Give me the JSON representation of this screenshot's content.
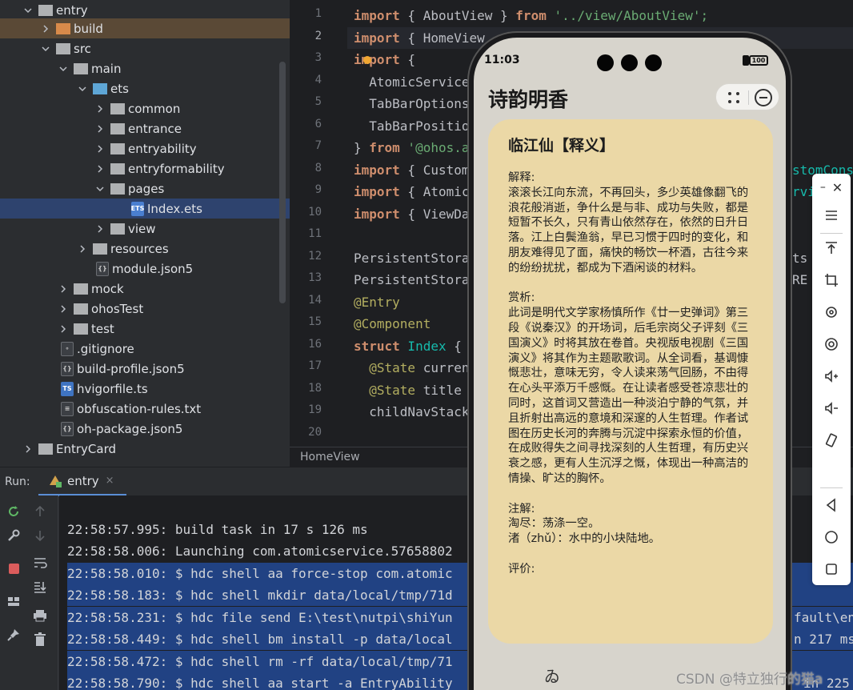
{
  "project_tree": {
    "items": [
      {
        "label": "entry",
        "kind": "module",
        "expanded": true
      },
      {
        "label": "build",
        "kind": "folder-orange",
        "expanded": false
      },
      {
        "label": "src",
        "kind": "folder",
        "expanded": true
      },
      {
        "label": "main",
        "kind": "folder",
        "expanded": true
      },
      {
        "label": "ets",
        "kind": "folder-blue",
        "expanded": true
      },
      {
        "label": "common",
        "kind": "folder",
        "expanded": false
      },
      {
        "label": "entrance",
        "kind": "folder",
        "expanded": false
      },
      {
        "label": "entryability",
        "kind": "folder",
        "expanded": false
      },
      {
        "label": "entryformability",
        "kind": "folder",
        "expanded": false
      },
      {
        "label": "pages",
        "kind": "folder",
        "expanded": true
      },
      {
        "label": "Index.ets",
        "kind": "file-ets",
        "selected": true
      },
      {
        "label": "view",
        "kind": "folder",
        "expanded": false
      },
      {
        "label": "resources",
        "kind": "folder",
        "expanded": false
      },
      {
        "label": "module.json5",
        "kind": "file-json"
      },
      {
        "label": "mock",
        "kind": "folder",
        "expanded": false
      },
      {
        "label": "ohosTest",
        "kind": "folder",
        "expanded": false
      },
      {
        "label": "test",
        "kind": "folder",
        "expanded": false
      },
      {
        "label": ".gitignore",
        "kind": "file-git"
      },
      {
        "label": "build-profile.json5",
        "kind": "file-json"
      },
      {
        "label": "hvigorfile.ts",
        "kind": "file-ts"
      },
      {
        "label": "obfuscation-rules.txt",
        "kind": "file-txt"
      },
      {
        "label": "oh-package.json5",
        "kind": "file-json"
      },
      {
        "label": "EntryCard",
        "kind": "folder",
        "expanded": false
      }
    ]
  },
  "editor": {
    "line_numbers": [
      "1",
      "2",
      "3",
      "4",
      "5",
      "6",
      "7",
      "8",
      "9",
      "10",
      "11",
      "12",
      "13",
      "14",
      "15",
      "16",
      "17",
      "18",
      "19",
      "20"
    ],
    "current_line": "2",
    "breadcrumb": "HomeView",
    "frag": {
      "l1a": "import",
      "l1b": " { AboutView } ",
      "l1c": "from",
      "l1d": " '../view/AboutView';",
      "l2a": "import",
      "l2b": " { HomeView",
      "l3a": "import",
      "l3b": " {",
      "l4": "  AtomicService",
      "l5": "  TabBarOptions",
      "l6": "  TabBarPositio",
      "l7a": "} ",
      "l7b": "from",
      "l7c": " '@ohos.a",
      "l8a": "import",
      "l8b": " { Custom",
      "l9a": "import",
      "l9b": " { Atomic",
      "l10a": "import",
      "l10b": " { ViewDa",
      "l12": "PersistentStora",
      "l13": "PersistentStora",
      "l14": "@Entry",
      "l15": "@Component",
      "l16a": "struct",
      "l16b": " Index",
      "l16c": " {",
      "l17a": "  @State",
      "l17b": " curren",
      "l18a": "  @State",
      "l18b": " title",
      "l19": "  childNavStack",
      "r8": "stomCons",
      "r9": "rvi",
      "r12": "ts",
      "r13": "RE"
    }
  },
  "run_panel": {
    "label": "Run:",
    "tab": "entry",
    "tab_close": "×",
    "lines": [
      {
        "text": "22:58:57.995: build task in 17 s 126 ms",
        "highlight": false
      },
      {
        "text": "22:58:58.006: Launching com.atomicservice.57658802",
        "highlight": false
      },
      {
        "text": "22:58:58.010: $ hdc shell aa force-stop com.atomic",
        "highlight": true
      },
      {
        "text": "22:58:58.183: $ hdc shell mkdir data/local/tmp/71d",
        "highlight": true
      },
      {
        "text": "22:58:58.231: $ hdc file send E:\\test\\nutpi\\shiYun",
        "highlight": true
      },
      {
        "text": "22:58:58.449: $ hdc shell bm install -p data/local",
        "highlight": true
      },
      {
        "text": "22:58:58.472: $ hdc shell rm -rf data/local/tmp/71",
        "highlight": true
      },
      {
        "text": "22:58:58.790: $ hdc shell aa start -a EntryAbility",
        "highlight": true
      }
    ],
    "right_frags": {
      "r3": "fault\\en",
      "r4": "n 217 ms",
      "r6": "in 225"
    }
  },
  "phone": {
    "time": "11:03",
    "battery": "100",
    "app_title": "诗韵明香",
    "poem": {
      "title": "临江仙【释义】",
      "explain_label": "解释:",
      "explain_text": "滚滚长江向东流，不再回头，多少英雄像翻飞的浪花般消逝，争什么是与非、成功与失败，都是短暂不长久，只有青山依然存在，依然的日升日落。江上白鬓渔翁，早已习惯于四时的变化，和朋友难得见了面，痛快的畅饮一杯酒，古往今来的纷纷扰扰，都成为下酒闲谈的材料。",
      "appreciate_label": "赏析:",
      "appreciate_text": "此词是明代文学家杨慎所作《廿一史弹词》第三段《说秦汉》的开场词，后毛宗岗父子评刻《三国演义》时将其放在卷首。央视版电视剧《三国演义》将其作为主题歌歌词。从全词看，基调慷慨悲壮，意味无穷，令人读来荡气回肠，不由得在心头平添万千感慨。在让读者感受苍凉悲壮的同时，这首词又营造出一种淡泊宁静的气氛，并且折射出高远的意境和深邃的人生哲理。作者试图在历史长河的奔腾与沉淀中探索永恒的价值，在成败得失之间寻找深刻的人生哲理，有历史兴衰之感，更有人生沉浮之慨，体现出一种高洁的情操、旷达的胸怀。",
      "notes_label": "注解:",
      "note1": "淘尽：荡涤一空。",
      "note2": "渚（zhǔ）：水中的小块陆地。",
      "review_label": "评价:"
    },
    "tab_icon": "ゐ"
  },
  "watermark": "CSDN @特立独行的猫a",
  "colors": {
    "keyword": "#cf8e6d",
    "string": "#6aab73",
    "annotation": "#b3ae60",
    "type": "#16baac",
    "card": "#ebd8a6",
    "console_highlight": "#214283"
  }
}
